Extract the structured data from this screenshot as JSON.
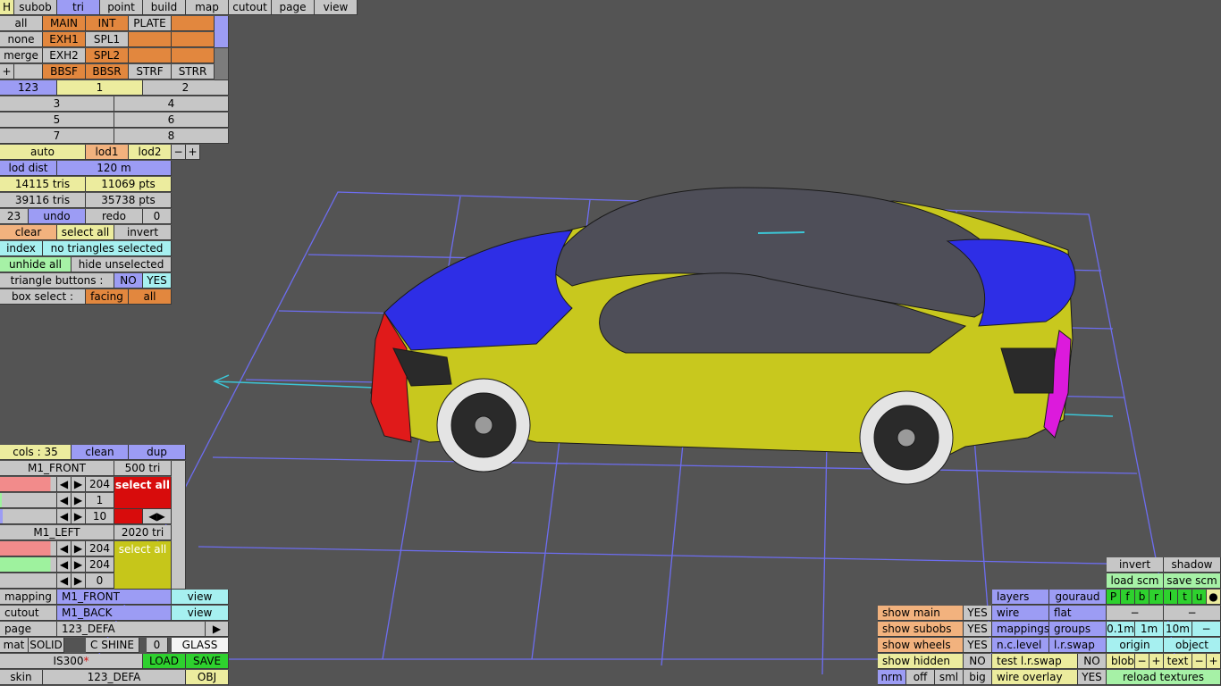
{
  "menu": {
    "h": "H",
    "items": [
      "subob",
      "tri",
      "point",
      "build",
      "map",
      "cutout",
      "page",
      "view"
    ]
  },
  "subob_grid": {
    "row1": [
      "all",
      "MAIN",
      "INT",
      "PLATE",
      ""
    ],
    "row2": [
      "none",
      "EXH1",
      "SPL1",
      "",
      ""
    ],
    "row3": [
      "merge",
      "EXH2",
      "SPL2",
      "",
      ""
    ],
    "row4": [
      "+",
      "",
      "BBSF",
      "BBSR",
      "STRF",
      "STRR"
    ]
  },
  "pages": {
    "row1": [
      "123",
      "1",
      "2"
    ],
    "row2": [
      "3",
      "4"
    ],
    "row3": [
      "5",
      "6"
    ],
    "row4": [
      "7",
      "8"
    ]
  },
  "lod": {
    "auto": "auto",
    "lod1": "lod1",
    "lod2": "lod2",
    "minus": "−",
    "plus": "+",
    "dist_label": "lod dist",
    "dist_value": "120 m"
  },
  "stats": {
    "tris1": "14115 tris",
    "pts1": "11069 pts",
    "tris2": "39116 tris",
    "pts2": "35738 pts"
  },
  "undo": {
    "count": "23",
    "undo": "undo",
    "redo": "redo",
    "redo_count": "0"
  },
  "selection": {
    "clear": "clear",
    "select_all": "select all",
    "invert": "invert",
    "index": "index",
    "status": "no triangles selected",
    "unhide_all": "unhide all",
    "hide_unselected": "hide unselected",
    "tri_buttons": "triangle buttons :",
    "no": "NO",
    "yes": "YES",
    "box_select": "box select :",
    "facing": "facing",
    "all": "all"
  },
  "colors": {
    "cols": "cols : 35",
    "clean": "clean",
    "dup": "dup"
  },
  "mat1": {
    "name": "M1_FRONT",
    "tri": "500 tri",
    "v1": "204",
    "v2": "1",
    "v3": "10",
    "select_all": "select all",
    "color": "#d80c0c"
  },
  "mat2": {
    "name": "M1_LEFT",
    "tri": "2020 tri",
    "v1": "204",
    "v2": "204",
    "v3": "0",
    "select_all": "select all",
    "color": "#c6c61a"
  },
  "bottom_left": {
    "mapping": "mapping",
    "mapping_val": "M1_FRONT",
    "view1": "view",
    "cutout": "cutout",
    "cutout_val": "M1_BACK",
    "view2": "view",
    "page": "page",
    "page_val": "123_DEFA",
    "page_arrow": "▶",
    "mat": "mat",
    "solid": "SOLID",
    "cshine": "C SHINE",
    "zero": "0",
    "glass": "GLASS",
    "model": "IS300",
    "star": "*",
    "load": "LOAD",
    "save": "SAVE",
    "skin": "skin",
    "skin_val": "123_DEFA",
    "obj": "OBJ"
  },
  "bottom_right": {
    "invert": "invert",
    "shadow": "shadow",
    "load_scm": "load scm",
    "save_scm": "save scm",
    "layers": "layers",
    "gouraud": "gouraud",
    "pfbrltu": [
      "P",
      "f",
      "b",
      "r",
      "l",
      "t",
      "u",
      "●"
    ],
    "show_main": "show main",
    "show_main_v": "YES",
    "wire": "wire",
    "flat": "flat",
    "dash1": "−",
    "dash2": "−",
    "show_subobs": "show subobs",
    "show_subobs_v": "YES",
    "mappings": "mappings",
    "groups": "groups",
    "m01": "0.1m",
    "m1": "1m",
    "m10": "10m",
    "mminus": "−",
    "show_wheels": "show wheels",
    "show_wheels_v": "YES",
    "nclevel": "n.c.level",
    "lrswap": "l.r.swap",
    "origin": "origin",
    "object": "object",
    "show_hidden": "show hidden",
    "show_hidden_v": "NO",
    "test_lr": "test l.r.swap",
    "test_lr_v": "NO",
    "blob": "blob",
    "bminus": "−",
    "bplus": "+",
    "text": "text",
    "tminus": "−",
    "tplus": "+",
    "nrm": "nrm",
    "off": "off",
    "sml": "sml",
    "big": "big",
    "wire_overlay": "wire overlay",
    "wire_overlay_v": "YES",
    "reload": "reload textures"
  }
}
